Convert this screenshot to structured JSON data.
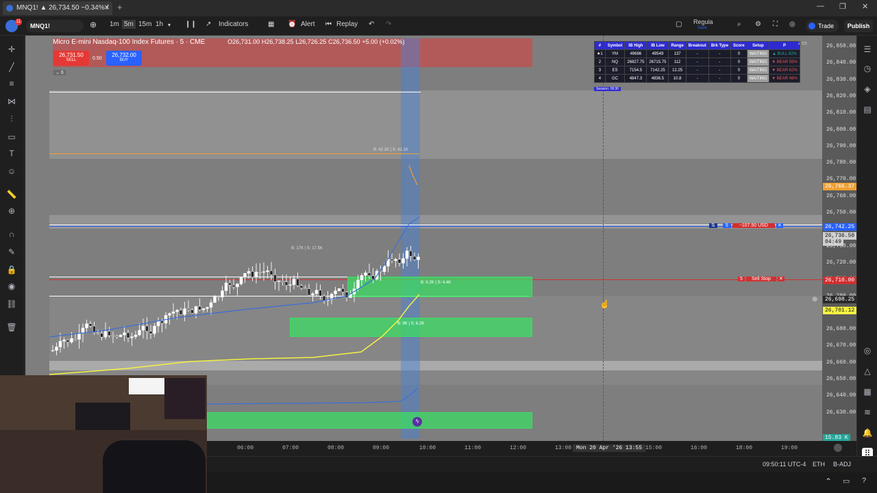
{
  "tab": {
    "title": "MNQ1! ▲ 26,734.50 −0.34% / "
  },
  "toolbar": {
    "symbol": "MNQ1!",
    "intervals": [
      "1m",
      "5m",
      "15m",
      "1h"
    ],
    "indicators_label": "Indicators",
    "alert_label": "Alert",
    "replay_label": "Replay",
    "layout_name": "Regula",
    "layout_sub": "Save",
    "trade_label": "Trade",
    "publish_label": "Publish"
  },
  "legend": {
    "title": "Micro E-mini Nasdaq-100 Index Futures · 5 · CME",
    "o": "26,731.00",
    "h": "26,738.25",
    "l": "26,726.25",
    "c": "26,736.50",
    "chg": "+5.00 (+0.02%)",
    "o_label": "O",
    "h_label": "H",
    "l_label": "L",
    "c_label": "C",
    "sell_price": "26,731.50",
    "sell_label": "SELL",
    "spread": "0.50",
    "buy_price": "26,732.00",
    "buy_label": "BUY",
    "indicator_count": "6"
  },
  "yaxis": {
    "labels": [
      "26,850.00",
      "26,840.00",
      "26,830.00",
      "26,820.00",
      "26,810.00",
      "26,800.00",
      "26,790.00",
      "26,780.00",
      "26,770.00",
      "26,760.00",
      "26,750.00",
      "26,740.00",
      "26,730.00",
      "26,720.00",
      "26,710.00",
      "26,700.00",
      "26,690.00",
      "26,680.00",
      "26,670.00",
      "26,660.00",
      "26,650.00",
      "26,640.00",
      "26,630.00"
    ],
    "badges": [
      {
        "text": "26,766.37",
        "color": "#f0a030"
      },
      {
        "text": "26,742.25",
        "color": "#2962ff"
      },
      {
        "text": "26,736.50",
        "color": "#d0d0d0"
      },
      {
        "text": "04:49",
        "color": "#d0d0d0"
      },
      {
        "text": "26,710.00",
        "color": "#d32f2f"
      },
      {
        "text": "26,698.25",
        "color": "#2a2a2a"
      },
      {
        "text": "26,701.12",
        "color": "#f5f242"
      },
      {
        "text": "15.83 K",
        "color": "#26a69a"
      }
    ]
  },
  "xaxis": {
    "labels": [
      "06:00",
      "07:00",
      "08:00",
      "09:00",
      "10:00",
      "11:00",
      "12:00",
      "13:00",
      "15:00",
      "16:00",
      "18:00",
      "19:00"
    ],
    "cursor_label": "Mon 20 Apr '26   13:55"
  },
  "status": {
    "time": "09:50:11 UTC-4",
    "session": "ETH",
    "adj": "B-ADJ"
  },
  "orders": {
    "position_qty": "5",
    "position_pnl": "−107.50 USD",
    "stop_qty": "5",
    "stop_label": "Sell Stop"
  },
  "zones": {
    "z1": "B: 5.2K | S: 4.4K",
    "z2": "B: 9K | S: 6.2K",
    "z3": "B: 17K | S: 17.5K",
    "z4": "B: 42.2K | S: 41.1K"
  },
  "ib_table": {
    "headers": [
      "#",
      "Symbol",
      "IB High",
      "IB Low",
      "Range",
      "Breakout",
      "Brk Type",
      "Score",
      "Setup",
      "P"
    ],
    "rows": [
      [
        "★1",
        "YM",
        "49686",
        "49549",
        "137",
        "-",
        "-",
        "0",
        "WAITING",
        "▲ BULL 82%"
      ],
      [
        "2",
        "NQ",
        "26827.75",
        "26715.75",
        "112",
        "-",
        "-",
        "0",
        "WAITING",
        "▼ BEAR 55%"
      ],
      [
        "3",
        "ES",
        "7154.5",
        "7142.25",
        "12.25",
        "-",
        "-",
        "0",
        "WAITING",
        "▼ BEAR 62%"
      ],
      [
        "4",
        "GC",
        "4847.3",
        "4836.5",
        "10.8",
        "-",
        "-",
        "0",
        "WAITING",
        "▼ BEAR 48%"
      ]
    ],
    "footer": "Session: 09:30"
  },
  "colors": {
    "accent": "#2962ff",
    "bull": "#26a69a",
    "bear": "#ef5350",
    "zone": "#4caf50",
    "vwap": "#f5f242"
  }
}
